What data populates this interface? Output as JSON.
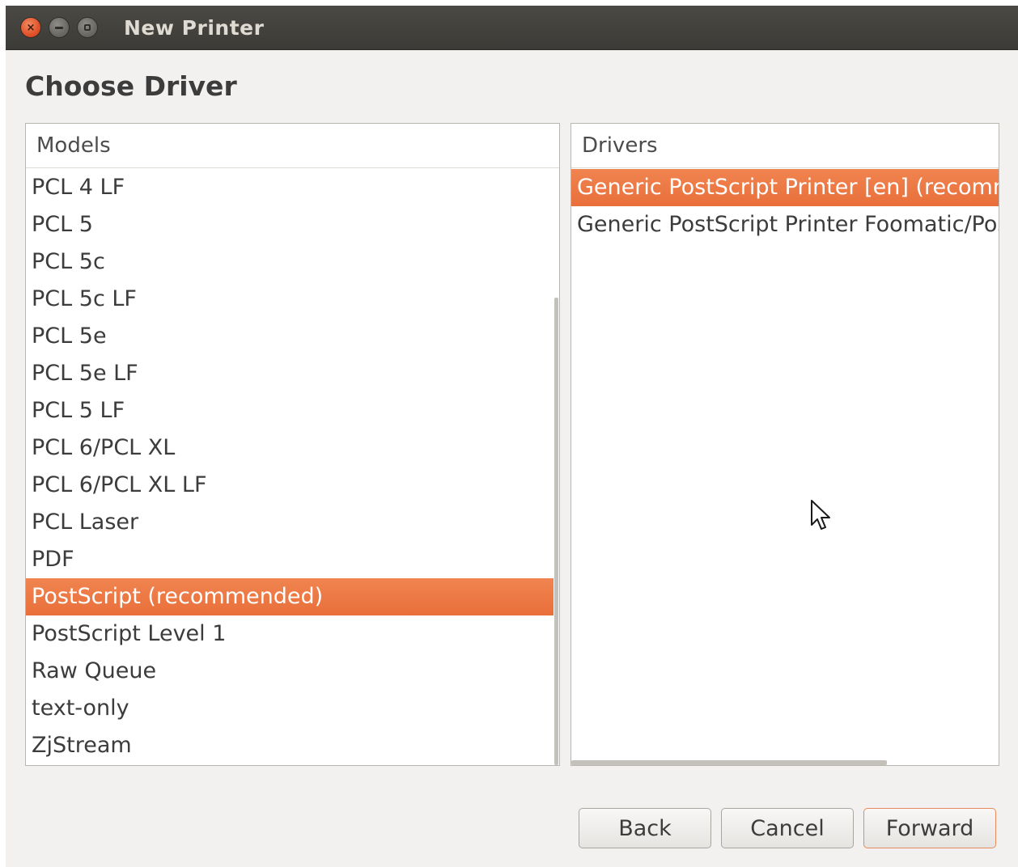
{
  "window": {
    "title": "New Printer",
    "close_glyph": "×"
  },
  "page": {
    "heading": "Choose Driver"
  },
  "models": {
    "header": "Models",
    "items": [
      "PCL 4 LF",
      "PCL 5",
      "PCL 5c",
      "PCL 5c LF",
      "PCL 5e",
      "PCL 5e LF",
      "PCL 5 LF",
      "PCL 6/PCL XL",
      "PCL 6/PCL XL LF",
      "PCL Laser",
      "PDF",
      "PostScript (recommended)",
      "PostScript Level 1",
      "Raw Queue",
      "text-only",
      "ZjStream"
    ],
    "selected_index": 11
  },
  "drivers": {
    "header": "Drivers",
    "items": [
      "Generic PostScript Printer [en] (recommended)",
      "Generic PostScript Printer Foomatic/Postscript [en]"
    ],
    "selected_index": 0
  },
  "buttons": {
    "back": "Back",
    "cancel": "Cancel",
    "forward": "Forward"
  },
  "colors": {
    "selection": "#e96f3a",
    "titlebar": "#3c3b37",
    "window_bg": "#f2f1f0"
  },
  "icons": {
    "close": "close-icon",
    "minimize": "minimize-icon",
    "maximize": "maximize-icon",
    "cursor": "mouse-pointer-icon"
  }
}
